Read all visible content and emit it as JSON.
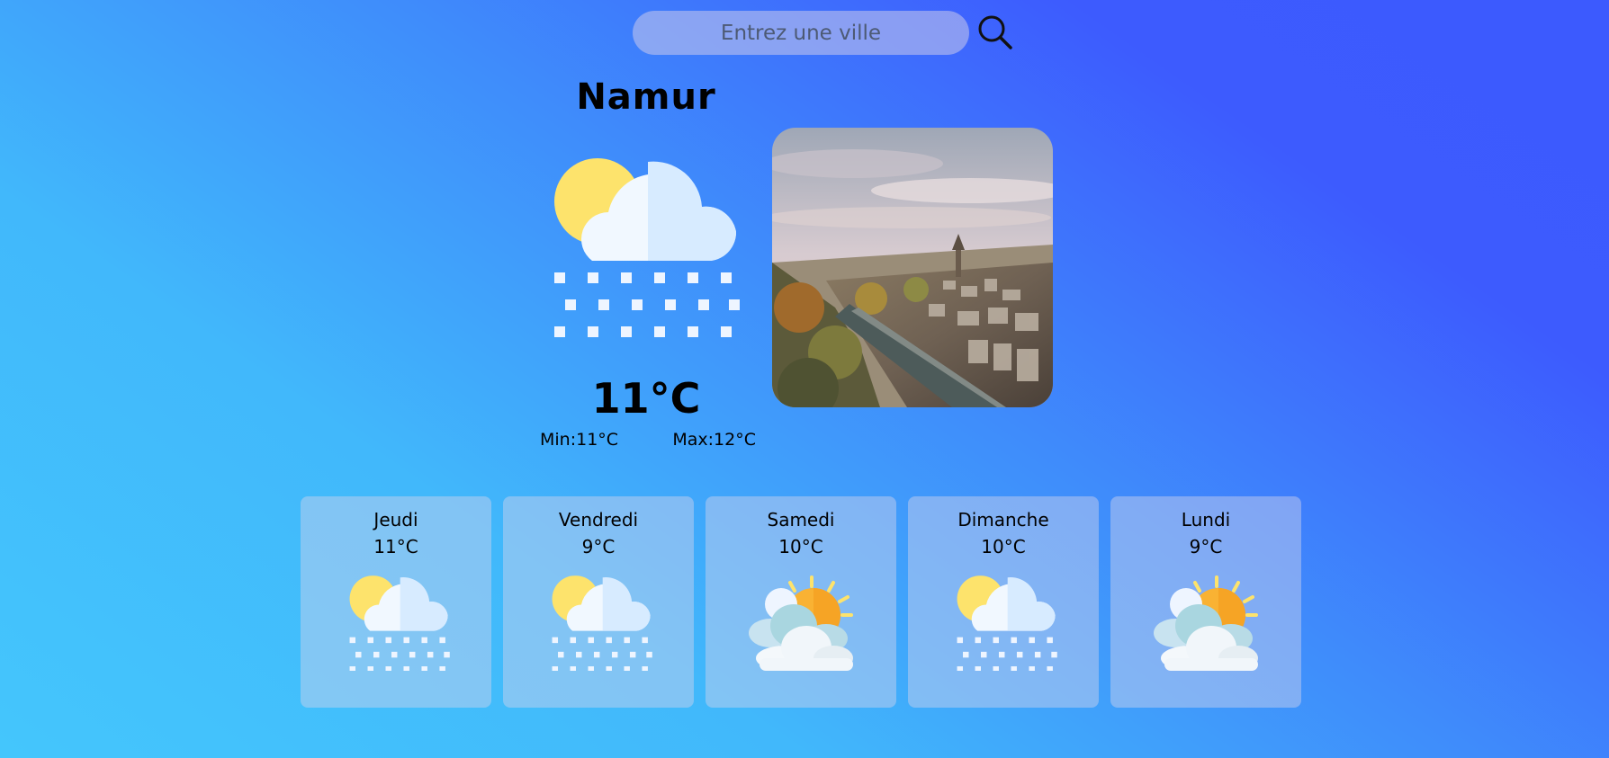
{
  "search": {
    "placeholder": "Entrez une ville"
  },
  "current": {
    "city": "Namur",
    "temperature": "11°C",
    "min": "Min:11°C",
    "max": "Max:12°C",
    "icon": "sun-cloud-snow-icon",
    "photo": "namur-city-photo"
  },
  "forecast": [
    {
      "day": "Jeudi",
      "temp": "11°C",
      "icon": "sun-cloud-snow-icon"
    },
    {
      "day": "Vendredi",
      "temp": "9°C",
      "icon": "sun-cloud-snow-icon"
    },
    {
      "day": "Samedi",
      "temp": "10°C",
      "icon": "partly-cloudy-icon"
    },
    {
      "day": "Dimanche",
      "temp": "10°C",
      "icon": "sun-cloud-snow-icon"
    },
    {
      "day": "Lundi",
      "temp": "9°C",
      "icon": "partly-cloudy-icon"
    }
  ],
  "colors": {
    "background_start": "#44c6fc",
    "background_end": "#3c5afe",
    "sun": "#fde36c",
    "cloud": "#eaf4ff",
    "partly_sun": "#f9b233"
  }
}
